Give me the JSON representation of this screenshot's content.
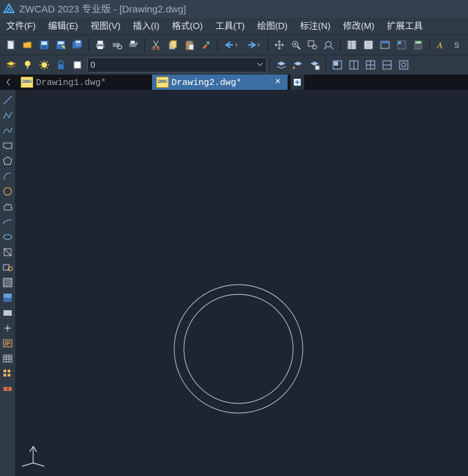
{
  "title": "ZWCAD 2023 专业版 - [Drawing2.dwg]",
  "menu": {
    "file": "文件(F)",
    "edit": "编辑(E)",
    "view": "视图(V)",
    "insert": "插入(I)",
    "format": "格式(O)",
    "tools": "工具(T)",
    "draw": "绘图(D)",
    "dim": "标注(N)",
    "modify": "修改(M)",
    "ext": "扩展工具"
  },
  "layer_combo": {
    "value": "0"
  },
  "tabs": [
    {
      "label": "Drawing1.dwg*",
      "active": false
    },
    {
      "label": "Drawing2.dwg*",
      "active": true
    }
  ],
  "toolbar1": {
    "new": "new-icon",
    "open": "open-icon",
    "save": "save-icon",
    "saveas": "saveas-icon",
    "saveall": "saveall-icon",
    "print": "print-icon",
    "preview": "print-preview-icon",
    "publish": "publish-icon",
    "cut": "cut-icon",
    "copy": "copy-icon",
    "paste": "paste-icon",
    "match": "match-prop-icon",
    "undo": "undo-icon",
    "redo": "redo-icon",
    "pan": "pan-icon",
    "zoom": "zoom-realtime-icon",
    "zoomwin": "zoom-window-icon",
    "zoomprev": "zoom-prev-icon",
    "props": "properties-icon",
    "sheet": "sheet-set-icon",
    "table": "table-icon",
    "tool": "tool-palettes-icon",
    "calc": "calc-icon",
    "text": "text-style-icon"
  },
  "toolbar2": {
    "layerprop": "layer-prop-icon",
    "bulb": "layer-on-icon",
    "sun": "layer-freeze-icon",
    "lock": "layer-lock-icon",
    "square": "layer-color-icon",
    "t2a": "icon",
    "t2b": "icon",
    "t2c": "icon",
    "t2d": "icon",
    "t2e": "icon",
    "t2f": "icon",
    "t2g": "icon",
    "t2h": "icon"
  },
  "left_tools": {
    "line": "line-icon",
    "pline": "polyline-icon",
    "spline": "spline-icon",
    "rect": "rectangle-icon",
    "polygon": "polygon-icon",
    "arc": "arc-icon",
    "circle": "circle-icon",
    "cloud": "revcloud-icon",
    "ellipse": "ellipse-icon",
    "earc": "ellipse-arc-icon",
    "block": "insert-block-icon",
    "make": "make-block-icon",
    "hatch": "hatch-icon",
    "grad": "gradient-icon",
    "region": "region-icon",
    "wipe": "wipeout-icon",
    "mtext": "mtext-icon",
    "more": "more-icon",
    "grid": "grid-icon",
    "end": "end-icon"
  }
}
